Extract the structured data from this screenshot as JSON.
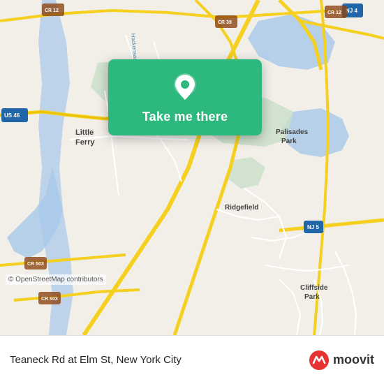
{
  "map": {
    "background_color": "#e8e0d8",
    "attribution": "© OpenStreetMap contributors"
  },
  "overlay": {
    "button_label": "Take me there",
    "background_color": "#2db87e"
  },
  "bottom_bar": {
    "location_text": "Teaneck Rd at Elm St, New York City",
    "logo_text": "moovit"
  }
}
